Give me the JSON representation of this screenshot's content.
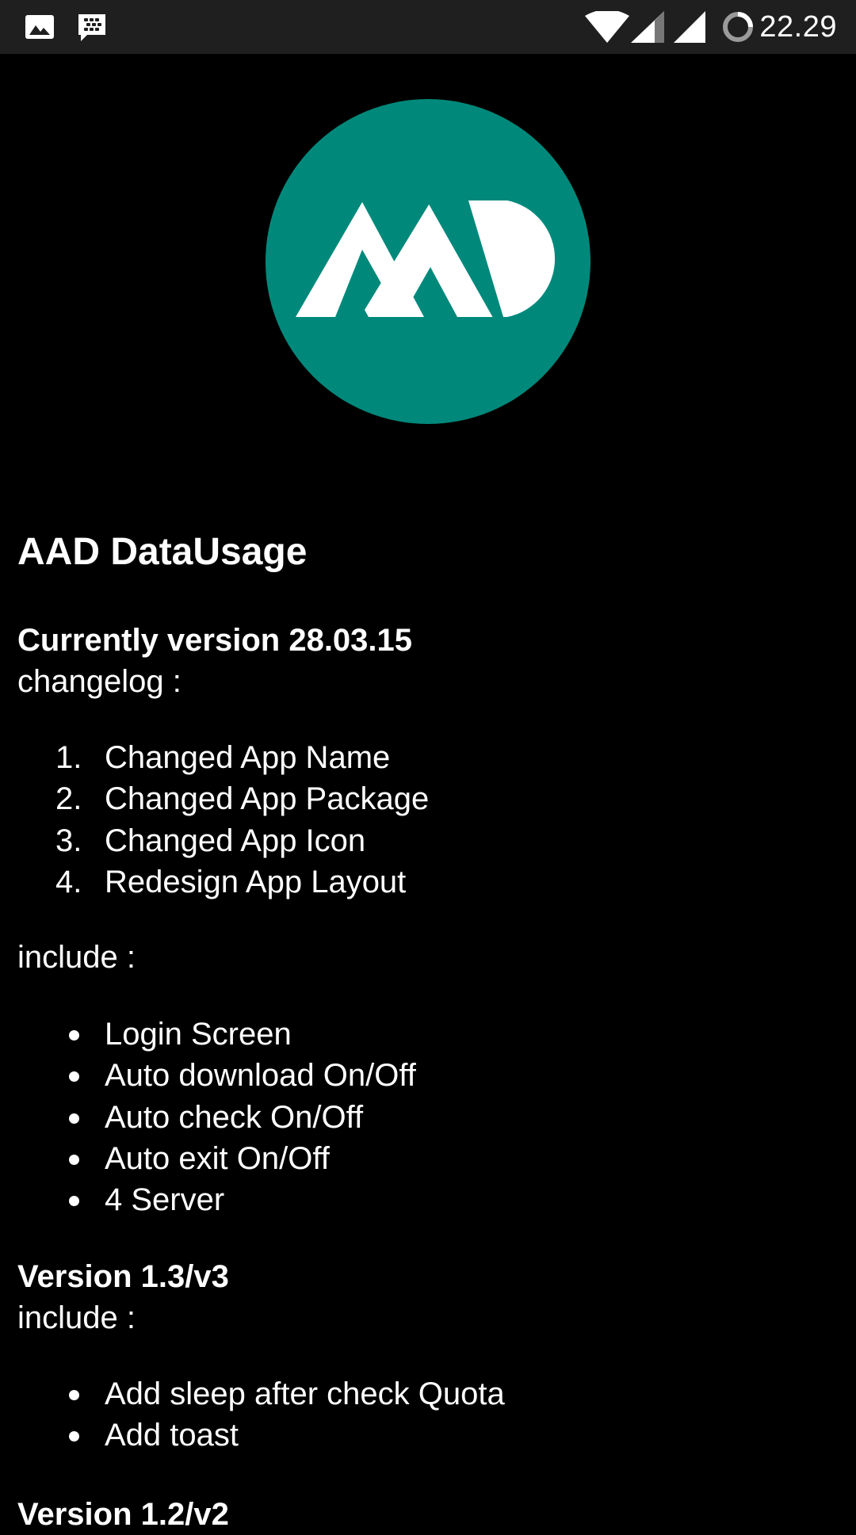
{
  "status_bar": {
    "time": "22.29",
    "left_icons": [
      "image-icon",
      "bbm-icon"
    ],
    "right_icons": [
      "wifi-icon",
      "signal-icon-1",
      "signal-icon-2",
      "sync-icon"
    ]
  },
  "logo": {
    "icon": "aad-logo",
    "color": "#00897B"
  },
  "app_title": "AAD DataUsage",
  "current": {
    "heading": "Currently version 28.03.15",
    "changelog_label": "changelog :",
    "changelog": [
      {
        "num": "1.",
        "text": "Changed App Name"
      },
      {
        "num": "2.",
        "text": "Changed App Package"
      },
      {
        "num": "3.",
        "text": "Changed App Icon"
      },
      {
        "num": "4.",
        "text": "Redesign App Layout"
      }
    ],
    "include_label": "include :",
    "include": [
      "Login Screen",
      "Auto download On/Off",
      "Auto check On/Off",
      "Auto exit On/Off",
      "4 Server"
    ]
  },
  "v13": {
    "heading": "Version 1.3/v3",
    "include_label": "include :",
    "include": [
      "Add sleep after check Quota",
      "Add toast"
    ]
  },
  "v12": {
    "heading": "Version 1.2/v2"
  }
}
